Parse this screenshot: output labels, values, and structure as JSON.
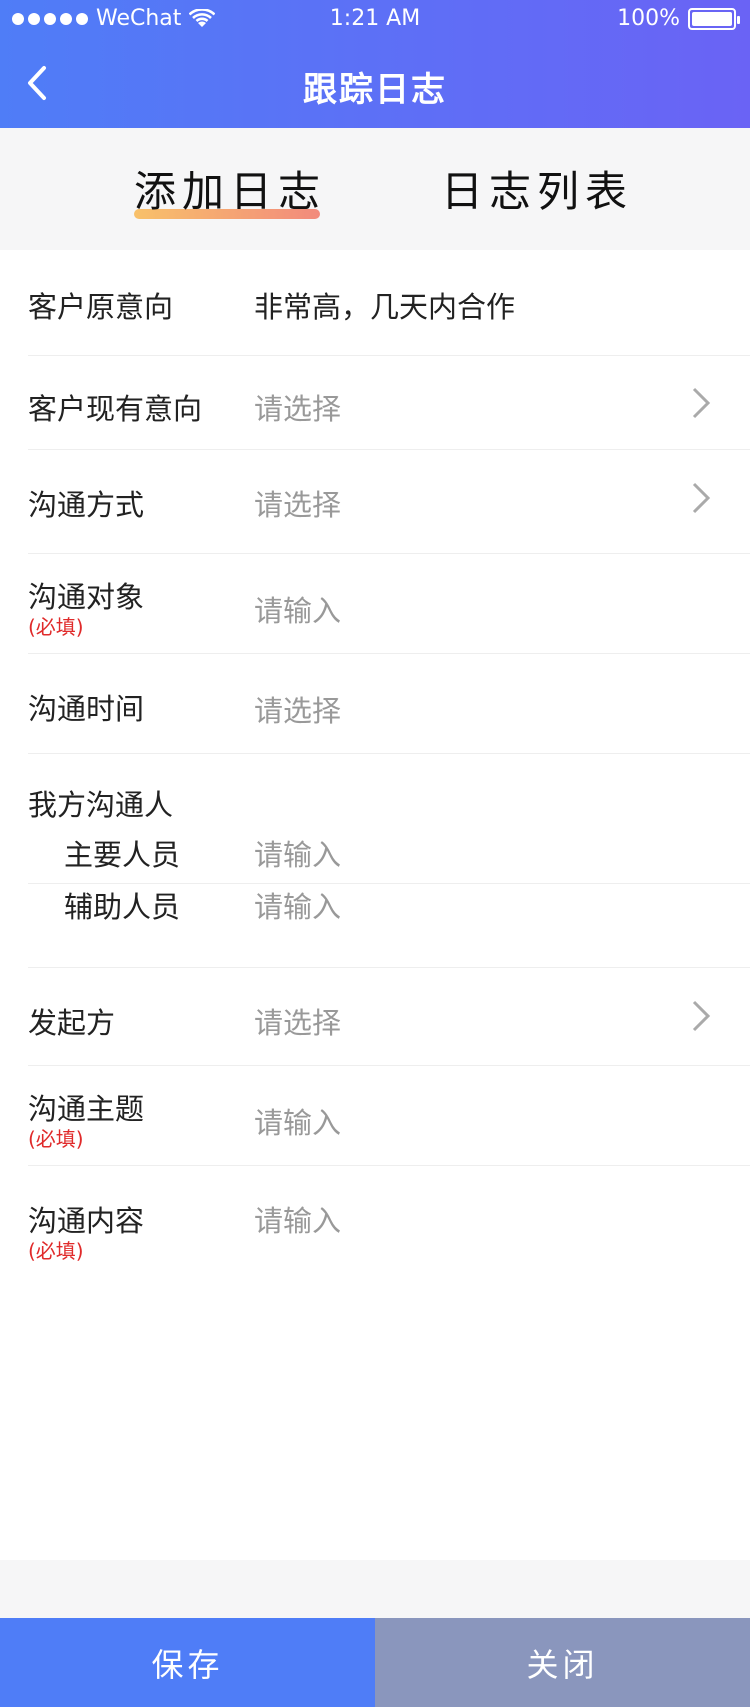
{
  "status_bar": {
    "carrier": "WeChat",
    "time": "1:21 AM",
    "battery": "100%",
    "battery_level": 1.0
  },
  "nav": {
    "title": "跟踪日志",
    "back_icon": "chevron-left-icon"
  },
  "tabs": [
    {
      "label": "添加日志",
      "active": true
    },
    {
      "label": "日志列表",
      "active": false
    }
  ],
  "form": {
    "original_intent": {
      "label": "客户原意向",
      "value": "非常高，几天内合作"
    },
    "current_intent": {
      "label": "客户现有意向",
      "placeholder": "请选择"
    },
    "comm_method": {
      "label": "沟通方式",
      "placeholder": "请选择"
    },
    "comm_target": {
      "label": "沟通对象",
      "required": "(必填)",
      "placeholder": "请输入"
    },
    "comm_time": {
      "label": "沟通时间",
      "placeholder": "请选择"
    },
    "our_contacts": {
      "label": "我方沟通人",
      "primary": {
        "label": "主要人员",
        "placeholder": "请输入"
      },
      "assistant": {
        "label": "辅助人员",
        "placeholder": "请输入"
      }
    },
    "initiator": {
      "label": "发起方",
      "placeholder": "请选择"
    },
    "comm_topic": {
      "label": "沟通主题",
      "required": "(必填)",
      "placeholder": "请输入"
    },
    "comm_content": {
      "label": "沟通内容",
      "required": "(必填)",
      "placeholder": "请输入"
    }
  },
  "buttons": {
    "save": "保存",
    "close": "关闭"
  },
  "colors": {
    "header_start": "#4f7df7",
    "header_end": "#6a63f5",
    "save_button": "#4f7df7",
    "close_button": "#8a96bd",
    "required_text": "#e02a2a",
    "tab_underline_start": "#f8c16a",
    "tab_underline_end": "#f28a7c"
  }
}
